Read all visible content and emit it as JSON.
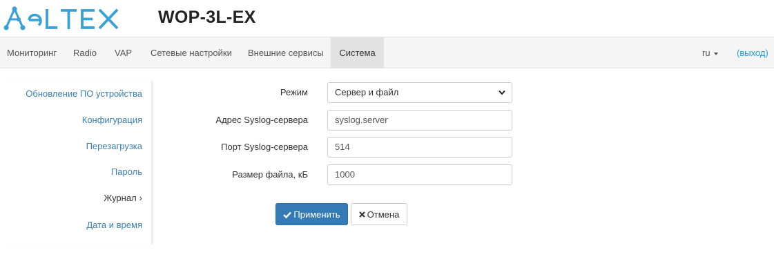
{
  "header": {
    "brand": "ELTEX",
    "model": "WOP-3L-EX"
  },
  "nav": {
    "items": [
      {
        "label": "Мониторинг"
      },
      {
        "label": "Radio"
      },
      {
        "label": "VAP"
      },
      {
        "label": "Сетевые настройки"
      },
      {
        "label": "Внешние сервисы"
      },
      {
        "label": "Система",
        "active": true
      }
    ],
    "language": "ru",
    "logout": "(выход)"
  },
  "sidebar": {
    "items": [
      {
        "label": "Обновление ПО устройства"
      },
      {
        "label": "Конфигурация"
      },
      {
        "label": "Перезагрузка"
      },
      {
        "label": "Пароль"
      },
      {
        "label": "Журнал",
        "active": true
      },
      {
        "label": "Дата и время"
      }
    ]
  },
  "form": {
    "mode": {
      "label": "Режим",
      "value": "Сервер и файл"
    },
    "server": {
      "label": "Адрес Syslog-сервера",
      "value": "syslog.server"
    },
    "port": {
      "label": "Порт Syslog-сервера",
      "value": "514"
    },
    "size": {
      "label": "Размер файла, кБ",
      "value": "1000"
    }
  },
  "buttons": {
    "apply": "Применить",
    "cancel": "Отмена"
  },
  "colors": {
    "brand": "#3aa0d8",
    "primary": "#337ab7",
    "link": "#3a7fb5",
    "logout": "#1a9fd6"
  }
}
